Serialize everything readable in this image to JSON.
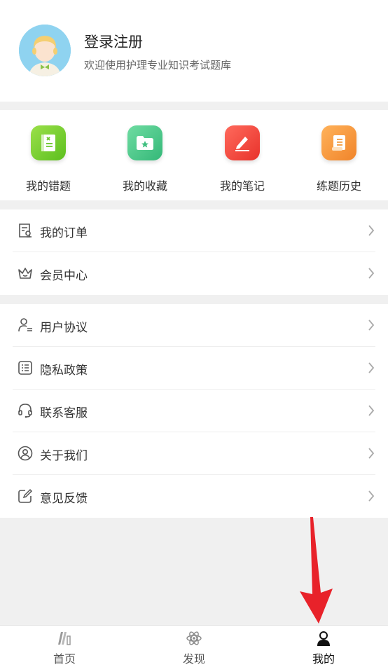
{
  "profile": {
    "name": "登录注册",
    "subtitle": "欢迎使用护理专业知识考试题库"
  },
  "quick_actions": [
    {
      "label": "我的错题",
      "icon": "notebook-icon",
      "color": "#7ccf2f"
    },
    {
      "label": "我的收藏",
      "icon": "star-folder-icon",
      "color": "#4cc98a"
    },
    {
      "label": "我的笔记",
      "icon": "pen-icon",
      "color": "#f5473f"
    },
    {
      "label": "练题历史",
      "icon": "scroll-icon",
      "color": "#f6963a"
    }
  ],
  "menu_group1": [
    {
      "label": "我的订单",
      "icon": "order-icon"
    },
    {
      "label": "会员中心",
      "icon": "crown-icon"
    }
  ],
  "menu_group2": [
    {
      "label": "用户协议",
      "icon": "user-agreement-icon"
    },
    {
      "label": "隐私政策",
      "icon": "list-icon"
    },
    {
      "label": "联系客服",
      "icon": "headset-icon"
    },
    {
      "label": "关于我们",
      "icon": "user-circle-icon"
    },
    {
      "label": "意见反馈",
      "icon": "edit-icon"
    }
  ],
  "tabs": [
    {
      "label": "首页",
      "icon": "books-icon"
    },
    {
      "label": "发现",
      "icon": "atom-icon"
    },
    {
      "label": "我的",
      "icon": "person-icon",
      "active": true
    }
  ],
  "colors": {
    "arrow": "#e8222a"
  }
}
